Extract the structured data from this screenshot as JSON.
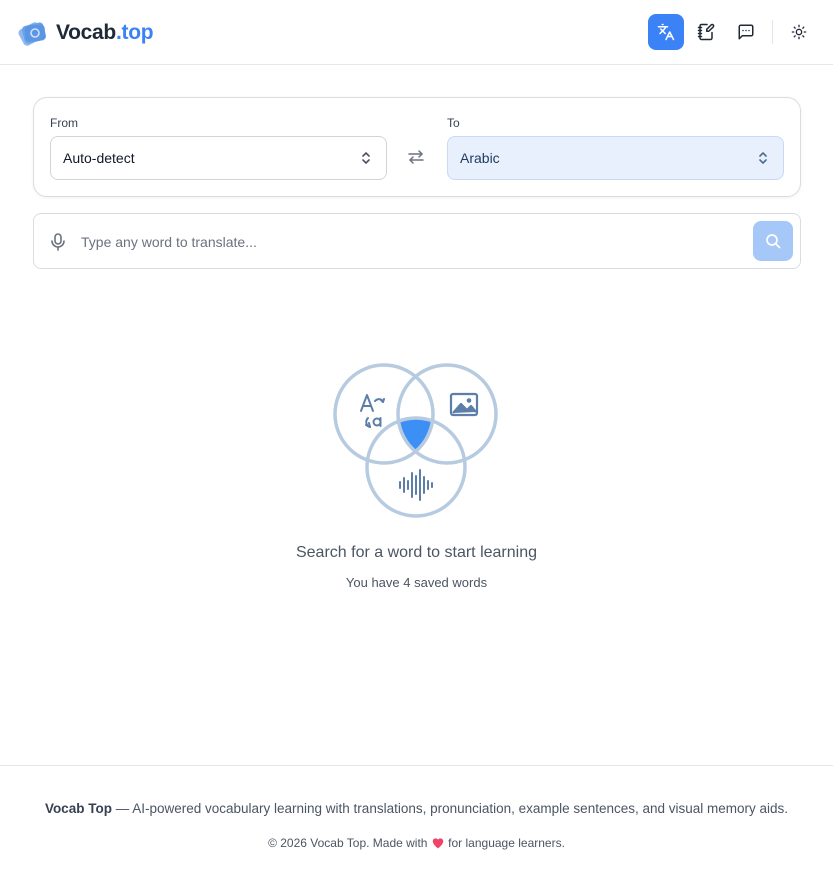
{
  "header": {
    "brand_name": "Vocab",
    "brand_accent": ".top",
    "buttons": [
      {
        "name": "translate-icon",
        "active": true
      },
      {
        "name": "edit-notebook-icon",
        "active": false
      },
      {
        "name": "chat-icon",
        "active": false
      },
      {
        "name": "sun-theme-icon",
        "active": false
      }
    ]
  },
  "language": {
    "from_label": "From",
    "from_value": "Auto-detect",
    "to_label": "To",
    "to_value": "Arabic"
  },
  "search": {
    "placeholder": "Type any word to translate...",
    "value": ""
  },
  "empty_state": {
    "title": "Search for a word to start learning",
    "subtitle": "You have 4 saved words"
  },
  "footer": {
    "brand": "Vocab Top",
    "description": " — AI-powered vocabulary learning with translations, pronunciation, example sentences, and visual memory aids.",
    "copy_prefix": "© 2026 Vocab Top. Made with",
    "copy_suffix": "for language learners."
  },
  "colors": {
    "accent": "#3b82f6",
    "search_button": "#a6c8f8",
    "to_select_bg": "#e8f0fd",
    "heart": "#ef4467"
  }
}
